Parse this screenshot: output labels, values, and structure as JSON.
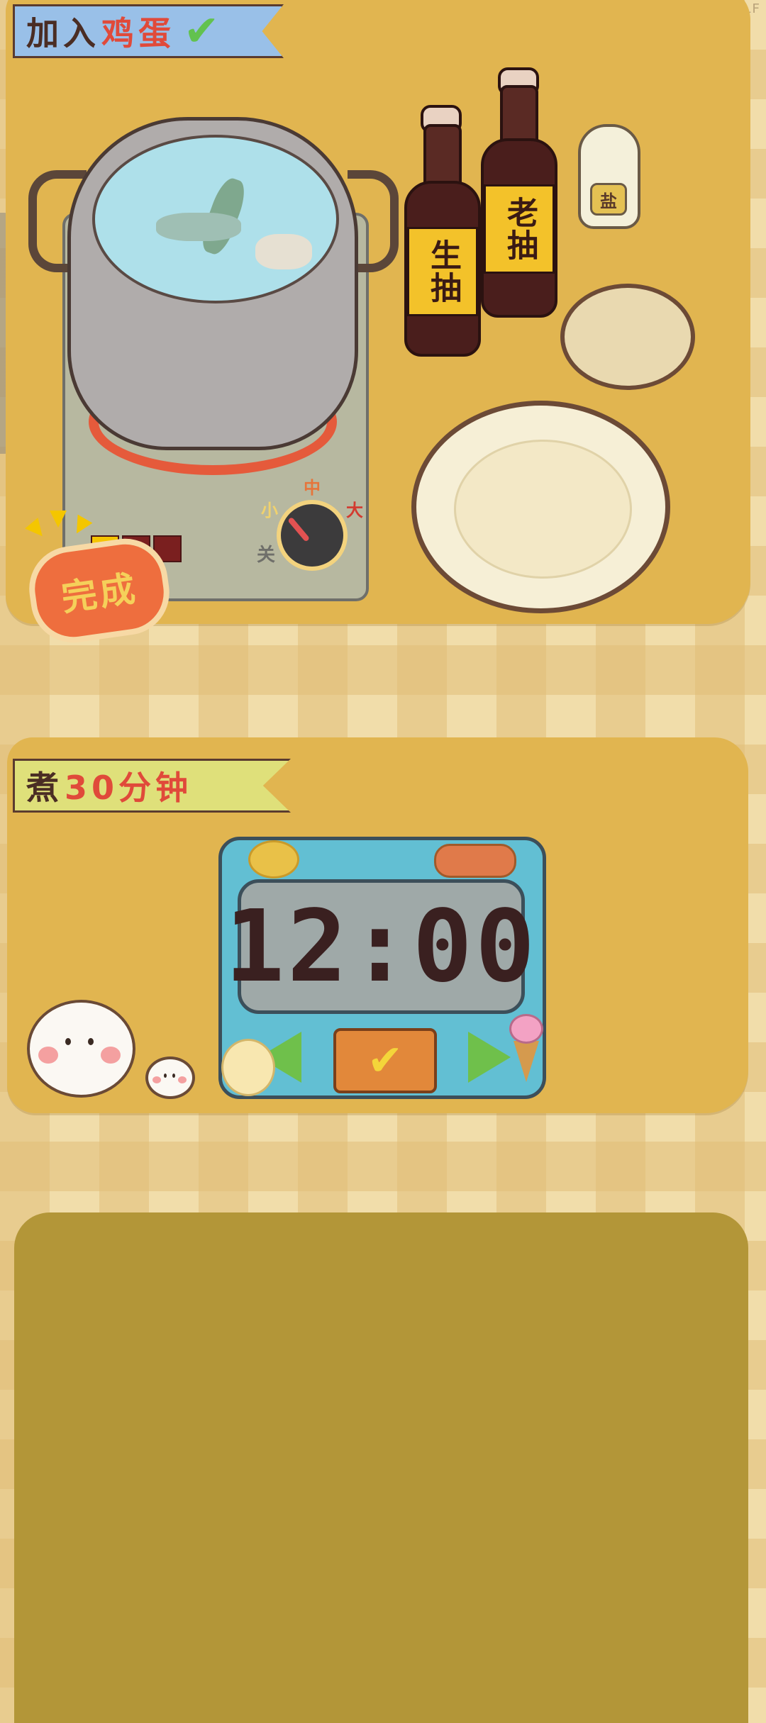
{
  "watermark": "ADBBDLF",
  "task_banner": {
    "prefix": "加入",
    "highlight": "鸡蛋",
    "status_icon": "check-icon"
  },
  "timer_banner": {
    "prefix": "煮",
    "highlight": "30分钟"
  },
  "stove": {
    "knob_labels": {
      "low": "小",
      "mid": "中",
      "high": "大",
      "off": "关"
    },
    "done_button": "完成"
  },
  "condiments": {
    "soy_light": "生抽",
    "soy_dark": "老抽",
    "salt": "盐"
  },
  "timer": {
    "display": "12:00",
    "confirm_icon": "check-icon",
    "left_icon": "arrow-left-icon",
    "right_icon": "arrow-right-icon"
  },
  "colors": {
    "panel": "#e1b550",
    "bottom_panel": "#b39638",
    "timer_body": "#62bfd3",
    "accent_red": "#e04a3a",
    "accent_green": "#6fc04b"
  }
}
